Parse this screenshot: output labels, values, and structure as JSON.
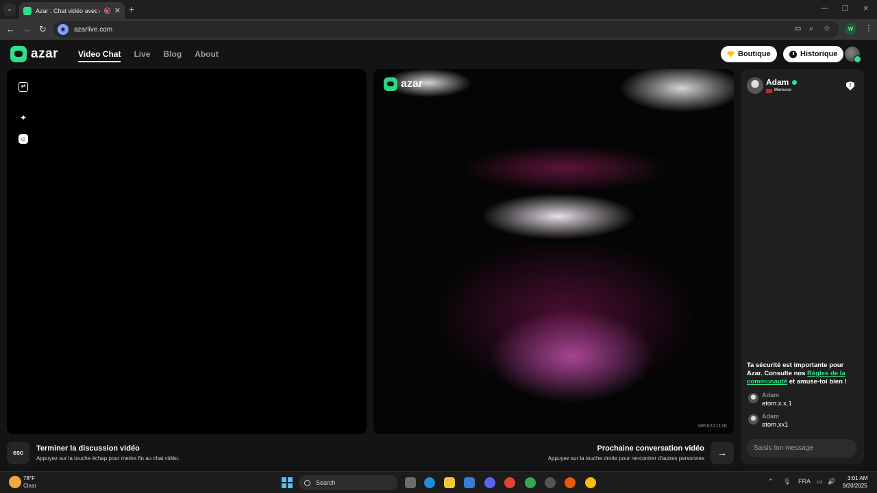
{
  "browser": {
    "tab_title": "Azar : Chat vidéo avec de n",
    "tab_close": "✕",
    "new_tab": "+",
    "url": "azarlive.com"
  },
  "site": {
    "logo_text": "azar",
    "nav": [
      "Video Chat",
      "Live",
      "Blog",
      "About"
    ],
    "boutique_label": "Boutique",
    "historique_label": "Historique"
  },
  "video": {
    "watermark": "azar",
    "code": "GBSU22111K"
  },
  "chat": {
    "partner_name": "Adam",
    "partner_country": "Morocco",
    "safety_prefix": "Ta sécurité est importante pour Azar. Consulte nos ",
    "safety_link": "Règles de la communauté",
    "safety_suffix": " et amuse-toi bien !",
    "messages": [
      {
        "author": "Adam",
        "text": "atom.x.x.1"
      },
      {
        "author": "Adam",
        "text": "atom.xx1"
      }
    ],
    "input_placeholder": "Saisis ton message"
  },
  "controls": {
    "esc_key": "esc",
    "end_title": "Terminer la discussion vidéo",
    "end_sub": "Appuyez sur la touche échap pour mettre fin au chat vidéo.",
    "next_title": "Prochaine conversation vidéo",
    "next_sub": "Appuyez sur la touche droite pour rencontrer d'autres personnes"
  },
  "taskbar": {
    "temp": "78°F",
    "condition": "Clear",
    "search": "Search",
    "lang": "FRA",
    "time": "3:01 AM",
    "date": "9/20/2025"
  },
  "colors": {
    "accent": "#2fe08a",
    "background": "#141414",
    "panel": "#1f1f1f"
  }
}
